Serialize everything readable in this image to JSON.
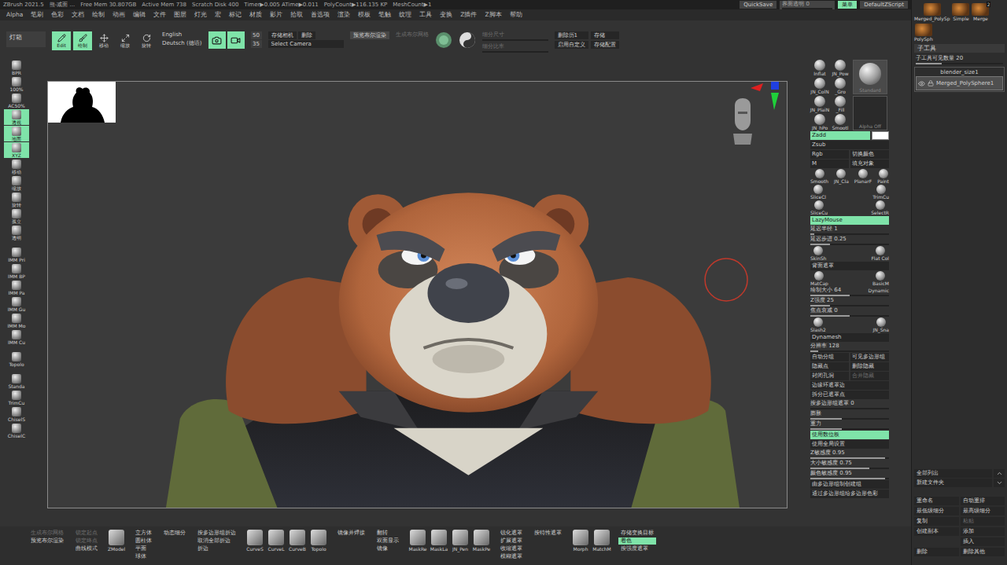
{
  "title_bar": {
    "items": [
      "ZBrush 2021.5",
      "熊-减面 ...",
      "Free Mem 30.807GB",
      "Active Mem 738",
      "Scratch Disk 400",
      "Timer▶0.005 ATime▶0.011",
      "PolyCount▶116.135 KP",
      "MeshCount▶1"
    ],
    "controls": [
      {
        "label": "QuickSave",
        "kind": "button",
        "active": false
      },
      {
        "label": "界面透明 0",
        "kind": "slider",
        "level": 0
      },
      {
        "label": "菜单",
        "kind": "button",
        "active": true
      },
      {
        "label": "DefaultZScript",
        "kind": "button",
        "active": false
      }
    ]
  },
  "menu_bar": [
    "Alpha",
    "笔刷",
    "色彩",
    "文档",
    "绘制",
    "动画",
    "编辑",
    "文件",
    "图层",
    "灯光",
    "宏",
    "标记",
    "材质",
    "影片",
    "拾取",
    "首选项",
    "渲染",
    "模板",
    "笔触",
    "纹理",
    "工具",
    "变换",
    "Z插件",
    "Z脚本",
    "帮助"
  ],
  "toolbar": {
    "lightbox": "灯箱",
    "modes": [
      {
        "label": "Edit",
        "active": true
      },
      {
        "label": "绘制",
        "active": true
      },
      {
        "label": "移动",
        "active": false
      },
      {
        "label": "缩放",
        "active": false
      },
      {
        "label": "旋转",
        "active": false
      }
    ],
    "languages": [
      "English",
      "Deutsch (德语)"
    ],
    "camera_toggles": [
      {
        "active": true
      },
      {
        "active": true
      }
    ],
    "lens": [
      "50",
      "35"
    ],
    "camera_buttons": [
      "存储相机",
      "删除"
    ],
    "select_camera": "Select Camera",
    "preview": "预览布尔渲染",
    "boolean": {
      "label": "生成布尔网格",
      "disabled": true
    },
    "sliders": [
      {
        "label": "细分尺寸",
        "level": 0,
        "disabled": true
      },
      {
        "label": "细分比率",
        "level": 0,
        "disabled": true
      }
    ],
    "history": [
      {
        "label": "删除历1",
        "disabled": false
      },
      {
        "label": "存储",
        "disabled": false
      },
      {
        "label": "启用自定义",
        "disabled": false
      },
      {
        "label": "存储配置",
        "disabled": false
      }
    ]
  },
  "left_shelf": [
    [
      {
        "label": "BPR",
        "active": false
      },
      {
        "label": "100%",
        "active": false
      },
      {
        "label": "AC50%",
        "active": false
      },
      {
        "label": "透视",
        "active": true
      },
      {
        "label": "地面",
        "active": true
      },
      {
        "label": "XYZ",
        "active": true
      },
      {
        "label": "移动",
        "active": false
      },
      {
        "label": "缩放",
        "active": false
      },
      {
        "label": "旋转",
        "active": false
      },
      {
        "label": "孤立",
        "active": false
      },
      {
        "label": "透明",
        "active": false
      }
    ],
    [
      {
        "label": "IMM Pri",
        "active": false
      },
      {
        "label": "IMM BP",
        "active": false
      },
      {
        "label": "IMM Pa",
        "active": false
      },
      {
        "label": "IMM Gu",
        "active": false
      },
      {
        "label": "IMM Mo",
        "active": false
      },
      {
        "label": "IMM Cu",
        "active": false
      }
    ],
    [
      {
        "label": "Topolo",
        "active": false
      }
    ],
    [
      {
        "label": "Standa",
        "active": false
      },
      {
        "label": "TrimCu",
        "active": false
      },
      {
        "label": "ChiselS",
        "active": false
      },
      {
        "label": "ChiselC",
        "active": false
      }
    ]
  ],
  "palette": {
    "brushes": [
      "Inflat",
      "JN_Pow",
      "JN_ColN",
      "_Gro",
      "JN_PlaiN",
      "_Fill",
      "JN_hPo",
      "Smootl"
    ],
    "current": "Standard",
    "alpha": "Alpha Off",
    "rows": [
      {
        "kind": "buttons",
        "items": [
          {
            "label": "Zadd",
            "active": true,
            "disabled": false
          }
        ],
        "color": "#ffffff"
      },
      {
        "kind": "buttons",
        "items": [
          {
            "label": "Zsub",
            "active": false,
            "disabled": false
          }
        ]
      },
      {
        "kind": "buttons",
        "items": [
          {
            "label": "Rgb",
            "active": false,
            "disabled": false
          },
          {
            "label": "切换颜色",
            "active": false,
            "disabled": false
          }
        ]
      },
      {
        "kind": "buttons",
        "items": [
          {
            "label": "M",
            "active": false,
            "disabled": false
          },
          {
            "label": "填充对象",
            "active": false,
            "disabled": false
          }
        ]
      },
      {
        "kind": "icons",
        "items": [
          "Smooth",
          "JN_Cla",
          "PlanarF",
          "Paint"
        ]
      },
      {
        "kind": "icons",
        "items": [
          "SliceCl",
          "TrimCu"
        ]
      },
      {
        "kind": "icons",
        "items": [
          "SliceCu",
          "SelectR"
        ]
      },
      {
        "kind": "buttons",
        "items": [
          {
            "label": "LazyMouse",
            "active": true,
            "disabled": false
          }
        ]
      },
      {
        "kind": "slider",
        "label": "延迟半径",
        "value": "1",
        "level": 0.05
      },
      {
        "kind": "slider",
        "label": "延迟步进",
        "value": "0.25",
        "level": 0.25
      },
      {
        "kind": "icons",
        "items": [
          "SkinSh",
          "Flat Col"
        ]
      },
      {
        "kind": "buttons",
        "items": [
          {
            "label": "背面遮罩",
            "active": false,
            "disabled": false
          }
        ]
      },
      {
        "kind": "icons",
        "items": [
          "MatCap",
          "BasicM"
        ]
      },
      {
        "kind": "slider",
        "label": "绘制大小",
        "value": "64",
        "level": 0.5,
        "tag": "Dynamic"
      },
      {
        "kind": "slider",
        "label": "Z强度",
        "value": "25",
        "level": 0.25
      },
      {
        "kind": "slider",
        "label": "焦点衰减",
        "value": "0",
        "level": 0.5
      },
      {
        "kind": "icons",
        "items": [
          "Slash2",
          "JN_Sna"
        ]
      },
      {
        "kind": "buttons",
        "items": [
          {
            "label": "Dynamesh",
            "active": false,
            "disabled": false
          }
        ]
      },
      {
        "kind": "slider",
        "label": "分辨率",
        "value": "128",
        "level": 0.1
      },
      {
        "kind": "buttons",
        "items": [
          {
            "label": "自动分组",
            "active": false,
            "disabled": false
          },
          {
            "label": "可见多边形组",
            "active": false,
            "disabled": false
          }
        ]
      },
      {
        "kind": "buttons",
        "items": [
          {
            "label": "隐藏点",
            "active": false,
            "disabled": false
          },
          {
            "label": "删除隐藏",
            "active": false,
            "disabled": false
          }
        ]
      },
      {
        "kind": "buttons",
        "items": [
          {
            "label": "封闭孔洞",
            "active": false,
            "disabled": false
          },
          {
            "label": "合并隐藏",
            "active": false,
            "disabled": true
          }
        ]
      },
      {
        "kind": "buttons",
        "items": [
          {
            "label": "边缘环遮罩边",
            "active": false,
            "disabled": false
          }
        ]
      },
      {
        "kind": "buttons",
        "items": [
          {
            "label": "拆分已遮罩点",
            "active": false,
            "disabled": false
          }
        ]
      },
      {
        "kind": "slider",
        "label": "按多边形组遮罩",
        "value": "0",
        "level": 0
      },
      {
        "kind": "slider",
        "label": "膨胀",
        "value": "",
        "level": 0.4
      },
      {
        "kind": "slider",
        "label": "重力",
        "value": "",
        "level": 0.4
      },
      {
        "kind": "buttons",
        "items": [
          {
            "label": "使用数位板",
            "active": true,
            "disabled": false
          }
        ]
      },
      {
        "kind": "buttons",
        "items": [
          {
            "label": "使用全局设置",
            "active": false,
            "disabled": false
          }
        ]
      },
      {
        "kind": "slider",
        "label": "Z敏感度",
        "value": "0.95",
        "level": 0.95
      },
      {
        "kind": "slider",
        "label": "大小敏感度",
        "value": "0.75",
        "level": 0.75
      },
      {
        "kind": "slider",
        "label": "颜色敏感度",
        "value": "0.95",
        "level": 0.95
      },
      {
        "kind": "buttons",
        "items": [
          {
            "label": "由多边形组制创建组",
            "active": false,
            "disabled": false
          }
        ]
      },
      {
        "kind": "buttons",
        "items": [
          {
            "label": "通过多边形组给多边形色彩",
            "active": false,
            "disabled": false
          }
        ]
      }
    ]
  },
  "tray": {
    "thumbs": [
      {
        "label": "Merged_PolySp",
        "badge": ""
      },
      {
        "label": "Simple",
        "badge": ""
      },
      {
        "label": "Merge",
        "badge": "2"
      },
      {
        "label": "PolySph",
        "badge": ""
      }
    ],
    "title": "子工具",
    "visible_count": {
      "label": "子工具可见数量 20",
      "level": 0.3
    },
    "folder": "blender_size1",
    "items": [
      {
        "name": "Merged_PolySphere1",
        "selected": true
      }
    ],
    "list_buttons": [
      "全部列出",
      "新建文件夹"
    ],
    "actions": [
      [
        {
          "label": "重命名",
          "disabled": false
        },
        {
          "label": "自动重排",
          "disabled": false
        }
      ],
      [
        {
          "label": "最低级细分",
          "disabled": false
        },
        {
          "label": "最高级细分",
          "disabled": false
        }
      ],
      [
        {
          "label": "复制",
          "disabled": false
        },
        {
          "label": "粘贴",
          "disabled": true
        }
      ],
      [
        {
          "label": "创建副本",
          "disabled": false
        },
        {
          "label": "添加",
          "disabled": false
        }
      ],
      [
        {
          "label": "插入",
          "disabled": false
        }
      ],
      [
        {
          "label": "删除",
          "disabled": false
        },
        {
          "label": "删除其他",
          "disabled": false
        }
      ]
    ]
  },
  "bottom_bar": [
    {
      "kind": "stack",
      "items": [
        {
          "label": "生成布尔网格",
          "active": false,
          "disabled": true
        },
        {
          "label": "预览布尔渲染",
          "active": false,
          "disabled": false
        }
      ]
    },
    {
      "kind": "stack",
      "items": [
        {
          "label": "锁定起点",
          "active": false,
          "disabled": true
        },
        {
          "label": "锁定终点",
          "active": false,
          "disabled": true
        },
        {
          "label": "曲线模式",
          "active": false,
          "disabled": false
        }
      ]
    },
    {
      "kind": "icons",
      "items": [
        "ZModel"
      ]
    },
    {
      "kind": "stack",
      "items": [
        {
          "label": "立方体",
          "active": false,
          "disabled": false
        },
        {
          "label": "圆柱体",
          "active": false,
          "disabled": false
        },
        {
          "label": "平面",
          "active": false,
          "disabled": false
        },
        {
          "label": "球体",
          "active": false,
          "disabled": false
        }
      ]
    },
    {
      "kind": "stack",
      "items": [
        {
          "label": "动态细分",
          "active": false,
          "disabled": false
        }
      ]
    },
    {
      "kind": "stack",
      "items": [
        {
          "label": "按多边形组折边",
          "active": false,
          "disabled": false
        },
        {
          "label": "取消全部折边",
          "active": false,
          "disabled": false
        },
        {
          "label": "折边",
          "active": false,
          "disabled": false
        }
      ]
    },
    {
      "kind": "icons",
      "items": [
        "CurveS",
        "CurveL",
        "CurveB",
        "Topolo"
      ]
    },
    {
      "kind": "stack",
      "items": [
        {
          "label": "镜像并焊接",
          "active": false,
          "disabled": false
        }
      ]
    },
    {
      "kind": "stack",
      "items": [
        {
          "label": "翻转",
          "active": false,
          "disabled": false
        },
        {
          "label": "双面显示",
          "active": false,
          "disabled": false
        },
        {
          "label": "镜像",
          "active": false,
          "disabled": false
        }
      ]
    },
    {
      "kind": "icons",
      "items": [
        "MaskRe",
        "MaskLa",
        "JN_Pen",
        "MaskPe"
      ]
    },
    {
      "kind": "stack",
      "items": [
        {
          "label": "锐化遮罩",
          "active": false,
          "disabled": false
        },
        {
          "label": "扩展遮罩",
          "active": false,
          "disabled": false
        },
        {
          "label": "收缩遮罩",
          "active": false,
          "disabled": false
        },
        {
          "label": "模糊遮罩",
          "active": false,
          "disabled": false
        }
      ]
    },
    {
      "kind": "stack",
      "items": [
        {
          "label": "按特性遮罩",
          "active": false,
          "disabled": false
        }
      ]
    },
    {
      "kind": "icons",
      "items": [
        "Morph",
        "MatchM"
      ]
    },
    {
      "kind": "stack",
      "items": [
        {
          "label": "存储变换目标",
          "active": false,
          "disabled": false
        },
        {
          "label": "着色",
          "active": true,
          "disabled": false
        },
        {
          "label": "按强度遮罩",
          "active": false,
          "disabled": false
        }
      ]
    }
  ]
}
